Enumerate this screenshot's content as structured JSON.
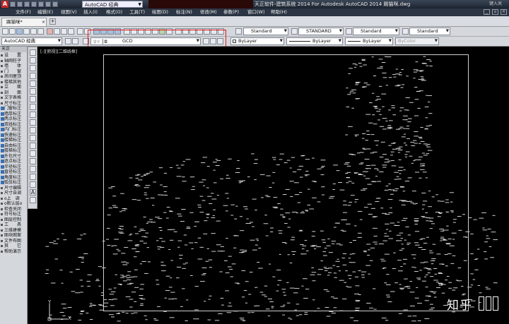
{
  "title_bar": {
    "workspace": "AutoCAD 经典",
    "window_title": "天正软件-建筑系统 2014  For Autodesk AutoCAD 2014   踢猫咪.dwg",
    "search_hint": "键入关"
  },
  "menu": {
    "items": [
      "文件(F)",
      "编辑(E)",
      "视图(V)",
      "插入(I)",
      "格式(O)",
      "工具(T)",
      "绘图(D)",
      "标注(N)",
      "修改(M)",
      "参数(P)",
      "窗口(W)",
      "帮助(H)"
    ]
  },
  "tabs": {
    "document": "踢猫咪*"
  },
  "toolbar1": {
    "text_style": "Standard",
    "dim_style": "STANDARD",
    "table_style": "Standard",
    "mleader_style": "Standard"
  },
  "toolbar2": {
    "workspace": "AutoCAD 经典",
    "layer": "GCD",
    "color": "ByLayer",
    "linetype": "ByLayer",
    "lineweight": "ByLayer",
    "plotstyle": "ByColor"
  },
  "palette": {
    "title": "天正",
    "items": [
      "设　　置",
      "轴网柱子",
      "墙　　体",
      "门　　窗",
      "房间屋顶",
      "楼梯其他",
      "立　　面",
      "剖　　面",
      "文字表格",
      "尺寸标注",
      "门窗标注",
      "墙厚标注",
      "两点标注",
      "双线标注",
      "内门标注",
      "快速标注",
      "楼梯标注",
      "自由标注",
      "楼梯标注",
      "外包尺寸",
      "逐点标注",
      "半径标注",
      "直径标注",
      "角度标注",
      "弧弦标注",
      "尺寸编辑",
      "尺寸自调",
      "o上　调",
      "o默认层o",
      "检查关闭",
      "符号标注",
      "图层控制",
      "工　　具",
      "三维建模",
      "图块图案",
      "文件布图",
      "其　　它",
      "帮助演示"
    ]
  },
  "viewport": {
    "label": "[-][俯视][二维线框]"
  },
  "ucs": {
    "y": "Y",
    "x": "X"
  },
  "watermark": {
    "text": "知乎"
  },
  "colors": {
    "highlight": "#e01a1a",
    "drawing_bg": "#000000",
    "toolbar_bg": "#d4d7dc"
  }
}
